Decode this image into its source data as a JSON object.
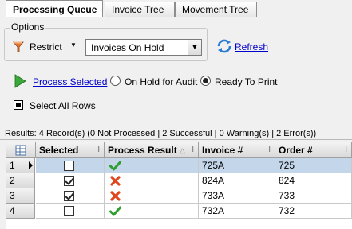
{
  "tabs": [
    {
      "label": "Processing Queue",
      "active": true
    },
    {
      "label": "Invoice Tree",
      "active": false
    },
    {
      "label": "Movement Tree",
      "active": false
    }
  ],
  "options": {
    "group_label": "Options",
    "restrict_label": "Restrict",
    "filter_value": "Invoices On Hold",
    "refresh_label": "Refresh"
  },
  "process": {
    "process_label": "Process Selected",
    "radio_on_hold": "On Hold for Audit",
    "radio_ready": "Ready To Print",
    "selected_radio": "Ready To Print",
    "select_all_label": "Select All Rows"
  },
  "results_text": "Results: 4 Record(s) (0 Not Processed | 2 Successful | 0 Warning(s) | 2 Error(s))",
  "grid": {
    "columns": [
      "Selected",
      "Process Result",
      "Invoice #",
      "Order #"
    ],
    "rows": [
      {
        "num": "1",
        "selected": false,
        "result": "success",
        "invoice": "725A",
        "order": "725",
        "current": true
      },
      {
        "num": "2",
        "selected": true,
        "result": "error",
        "invoice": "824A",
        "order": "824",
        "current": false
      },
      {
        "num": "3",
        "selected": true,
        "result": "error",
        "invoice": "733A",
        "order": "733",
        "current": false
      },
      {
        "num": "4",
        "selected": false,
        "result": "success",
        "invoice": "732A",
        "order": "732",
        "current": false
      }
    ]
  },
  "colors": {
    "link": "#0000cc",
    "success": "#2e9e2e",
    "error": "#e0461c",
    "selection": "#c4d6ea"
  }
}
